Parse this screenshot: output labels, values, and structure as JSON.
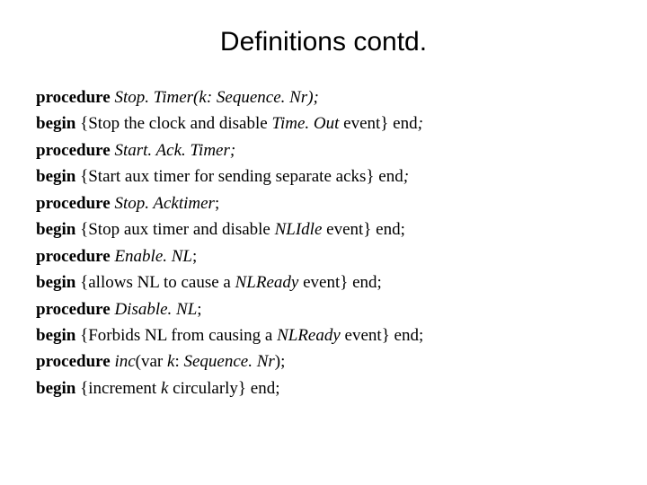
{
  "title": "Definitions contd.",
  "lines": {
    "l0": {
      "t0": "procedure ",
      "t1": "Stop. Timer(k: Sequence. Nr);"
    },
    "l1": {
      "t0": "begin ",
      "t1": "{Stop the clock and disable ",
      "t2": "Time. Out",
      "t3": " event} end",
      "t4": ";"
    },
    "l2": {
      "t0": "procedure ",
      "t1": "Start. Ack. Timer;"
    },
    "l3": {
      "t0": "begin ",
      "t1": "{Start aux timer for sending separate acks} end",
      "t2": ";"
    },
    "l4": {
      "t0": "procedure ",
      "t1": "Stop. Acktimer",
      "t2": ";"
    },
    "l5": {
      "t0": "begin ",
      "t1": "{Stop aux timer and disable ",
      "t2": "NLIdle",
      "t3": " event} end;"
    },
    "l6": {
      "t0": "procedure ",
      "t1": "Enable. NL",
      "t2": ";"
    },
    "l7": {
      "t0": "begin ",
      "t1": "{allows NL to cause a ",
      "t2": "NLReady",
      "t3": " event} end;"
    },
    "l8": {
      "t0": "procedure ",
      "t1": "Disable. NL",
      "t2": ";"
    },
    "l9": {
      "t0": "begin ",
      "t1": "{Forbids NL from causing a ",
      "t2": "NLReady",
      "t3": " event} end;"
    },
    "l10": {
      "t0": "procedure ",
      "t1": "inc",
      "t2": "(var ",
      "t3": "k",
      "t4": ": ",
      "t5": "Sequence. Nr",
      "t6": ");"
    },
    "l11": {
      "t0": "begin ",
      "t1": "{increment ",
      "t2": "k",
      "t3": " circularly} end;"
    }
  }
}
